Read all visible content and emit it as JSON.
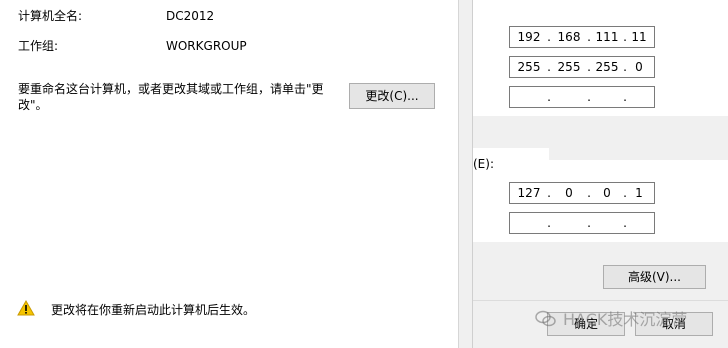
{
  "computer": {
    "full_name_label": "计算机全名:",
    "full_name_value": "DC2012",
    "workgroup_label": "工作组:",
    "workgroup_value": "WORKGROUP",
    "rename_text_line1": "要重命名这台计算机，或者更改其域或工作组，请单击\"更",
    "rename_text_line2": "改\"。",
    "change_button": "更改(C)...",
    "warning_text": "更改将在你重新启动此计算机后生效。"
  },
  "tcpip": {
    "ip_address": [
      "192",
      "168",
      "111",
      "11"
    ],
    "subnet_mask": [
      "255",
      "255",
      "255",
      "0"
    ],
    "gateway": [
      "",
      "",
      "",
      ""
    ],
    "dns_label_fragment": "(E):",
    "preferred_dns": [
      "127",
      "0",
      "0",
      "1"
    ],
    "alternate_dns": [
      "",
      "",
      "",
      ""
    ],
    "advanced_button": "高级(V)...",
    "ok_button": "确定",
    "cancel_button": "取消",
    "dot": "."
  },
  "watermark": {
    "text": "HACK技术沉淀营",
    "icon": "wechat-icon"
  },
  "colors": {
    "warning_yellow": "#f5c400",
    "button_face": "#e5e5e5",
    "dialog_bg": "#f0f0f0"
  }
}
